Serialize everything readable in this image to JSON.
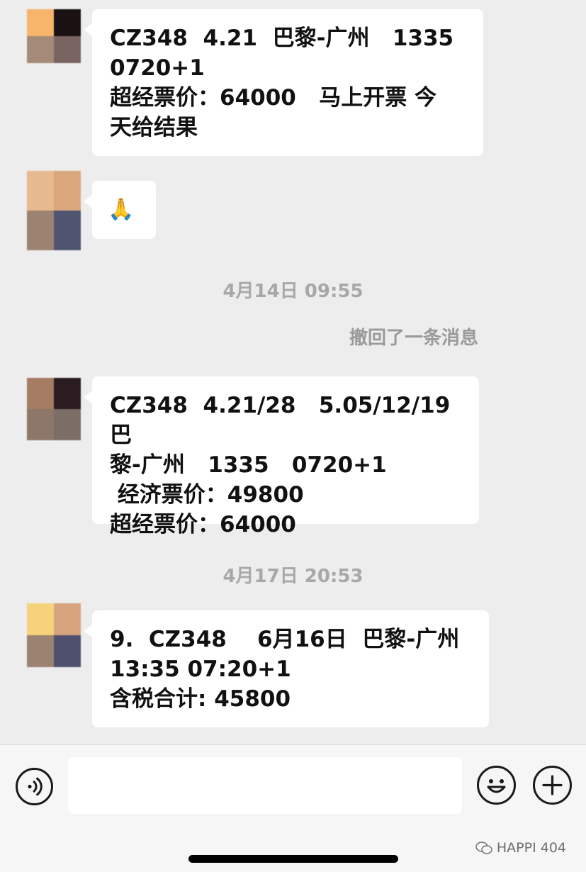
{
  "messages": [
    {
      "text": "CZ348  4.21  巴黎-广州   1335\n0720+1\n超经票价：64000   马上开票 今\n天给结果"
    },
    {
      "text": "🙏"
    },
    {
      "text": "CZ348  4.21/28   5.05/12/19  巴\n黎-广州   1335   0720+1\n 经济票价：49800\n超经票价：64000"
    },
    {
      "text": "9.  CZ348    6月16日  巴黎-广州\n13:35 07:20+1\n含税合计: 45800"
    }
  ],
  "timestamps": [
    "4月14日 09:55",
    "4月17日 20:53"
  ],
  "recall_notice": "撤回了一条消息",
  "toolbar": {
    "voice_icon": "voice-icon",
    "emoji_icon": "emoji-icon",
    "plus_icon": "plus-icon"
  },
  "watermark": "HAPPI 404"
}
